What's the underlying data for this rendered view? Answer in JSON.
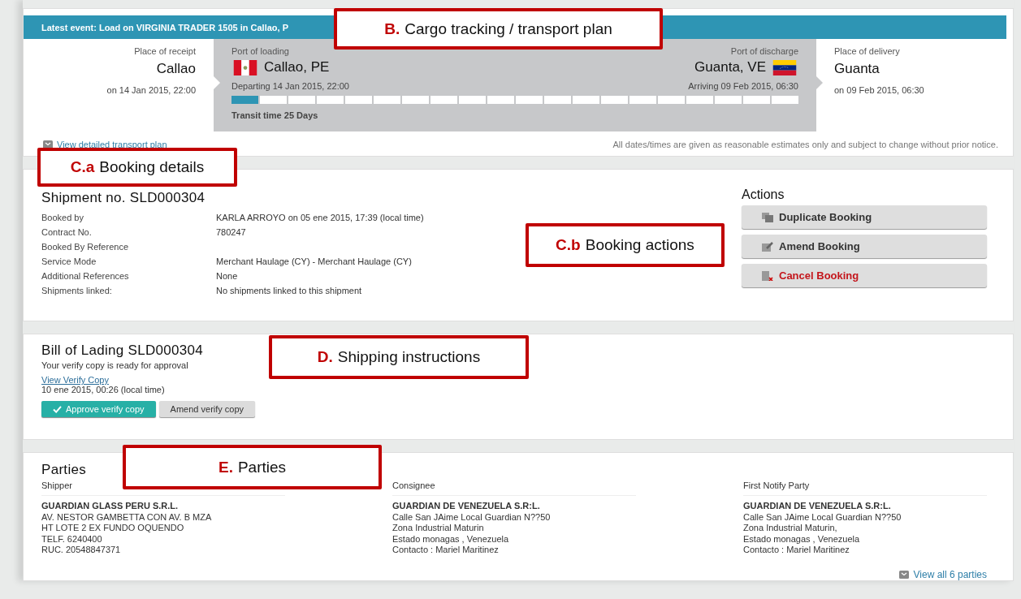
{
  "tracking": {
    "latest_event": "Latest event: Load on VIRGINIA TRADER 1505 in Callao, P",
    "receipt": {
      "label": "Place of receipt",
      "place": "Callao",
      "time": "on 14 Jan 2015, 22:00"
    },
    "loading": {
      "label": "Port of loading",
      "place": "Callao, PE",
      "time": "Departing 14 Jan 2015, 22:00"
    },
    "discharge": {
      "label": "Port of discharge",
      "place": "Guanta, VE",
      "time": "Arriving 09 Feb 2015, 06:30"
    },
    "delivery": {
      "label": "Place of delivery",
      "place": "Guanta",
      "time": "on 09 Feb 2015, 06:30"
    },
    "progress": {
      "level": 0.05
    },
    "transit": "Transit time 25 Days",
    "plan_link": "View detailed transport plan",
    "disclaimer": "All dates/times are given as reasonable estimates only and subject to change without prior notice."
  },
  "booking": {
    "title": "Shipment no. SLD000304",
    "fields": [
      {
        "label": "Booked by",
        "value": "KARLA ARROYO on 05 ene 2015, 17:39 (local time)"
      },
      {
        "label": "Contract No.",
        "value": "780247"
      },
      {
        "label": "Booked By Reference"
      },
      {
        "label": "Service Mode",
        "value": "Merchant Haulage (CY) - Merchant Haulage (CY)"
      },
      {
        "label": "Additional References",
        "value": "None"
      },
      {
        "label": "Shipments linked:",
        "value": "No shipments linked to this shipment"
      }
    ],
    "actions_title": "Actions",
    "actions": [
      {
        "label": "Duplicate Booking",
        "kind": "duplicate"
      },
      {
        "label": "Amend Booking",
        "kind": "amend"
      },
      {
        "label": "Cancel Booking",
        "kind": "cancel"
      }
    ]
  },
  "bill_of_lading": {
    "title": "Bill of Lading SLD000304",
    "status": "Your verify copy is ready for approval",
    "link": "View Verify Copy",
    "time": "10 ene 2015, 00:26 (local time)",
    "buttons": [
      {
        "label": "Approve verify copy",
        "kind": "primary"
      },
      {
        "label": "Amend verify copy",
        "kind": "secondary"
      }
    ]
  },
  "parties": {
    "title": "Parties",
    "columns": [
      {
        "role": "Shipper",
        "lines": [
          "GUARDIAN GLASS PERU S.R.L.",
          "AV. NESTOR GAMBETTA CON AV. B MZA",
          "HT LOTE 2 EX FUNDO OQUENDO",
          "TELF. 6240400",
          "RUC. 20548847371"
        ]
      },
      {
        "role": "Consignee",
        "lines": [
          "GUARDIAN DE VENEZUELA S.R:L.",
          "Calle San JAime Local Guardian N??50",
          "Zona Industrial Maturin",
          "Estado monagas , Venezuela",
          "Contacto : Mariel Maritinez"
        ]
      },
      {
        "role": "First Notify Party",
        "lines": [
          "GUARDIAN DE VENEZUELA S.R:L.",
          "Calle San JAime Local Guardian N??50",
          "Zona Industrial Maturin,",
          "Estado monagas , Venezuela",
          "Contacto : Mariel Maritinez"
        ]
      }
    ],
    "link": "View all 6 parties"
  },
  "callouts": [
    {
      "letter": "B.",
      "text": "Cargo tracking / transport plan"
    },
    {
      "letter": "C.a",
      "text": "Booking details"
    },
    {
      "letter": "C.b",
      "text": "Booking actions"
    },
    {
      "letter": "D.",
      "text": "Shipping instructions"
    },
    {
      "letter": "E.",
      "text": "Parties"
    }
  ]
}
